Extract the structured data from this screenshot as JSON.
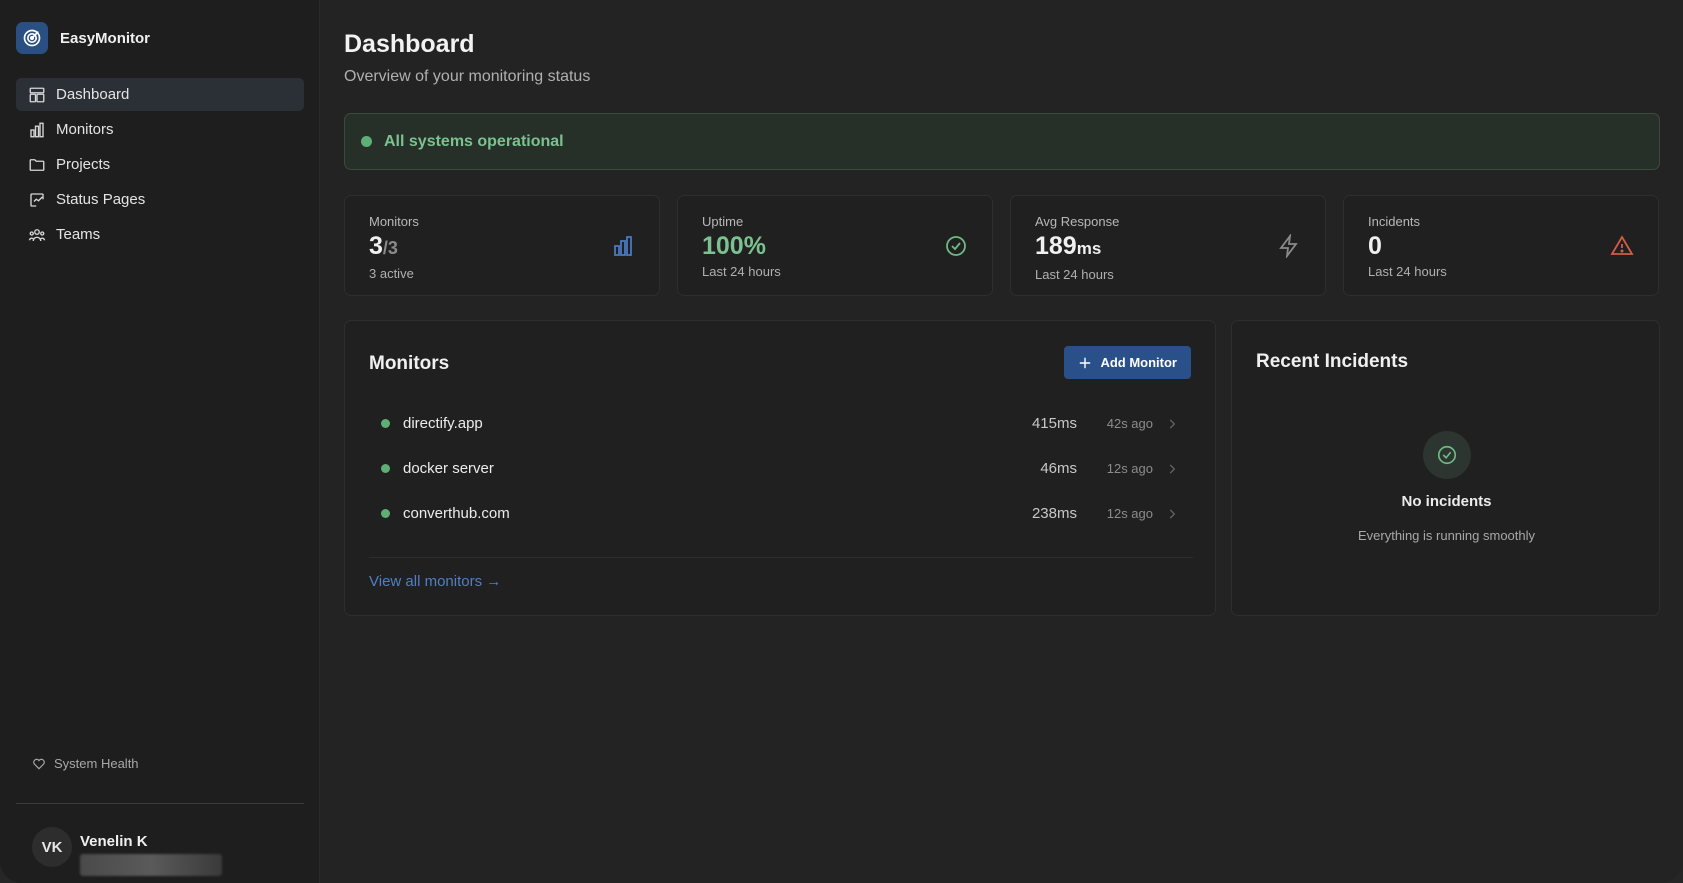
{
  "app": {
    "name": "EasyMonitor",
    "logo_icon": "radar-icon",
    "accent": "#2a5089"
  },
  "sidebar": {
    "items": [
      {
        "label": "Dashboard",
        "icon": "dashboard-icon",
        "active": true
      },
      {
        "label": "Monitors",
        "icon": "bar-chart-icon"
      },
      {
        "label": "Projects",
        "icon": "folder-icon"
      },
      {
        "label": "Status Pages",
        "icon": "status-page-icon"
      },
      {
        "label": "Teams",
        "icon": "users-icon"
      }
    ],
    "system_health": "System Health",
    "user": {
      "initials": "VK",
      "name": "Venelin K"
    }
  },
  "header": {
    "title": "Dashboard",
    "subtitle": "Overview of your monitoring status"
  },
  "status": {
    "text": "All systems operational",
    "color": "#5fae76"
  },
  "stats": [
    {
      "label": "Monitors",
      "value": "3",
      "sub": "/3",
      "note": "3 active",
      "icon": "bar-chart-icon"
    },
    {
      "label": "Uptime",
      "value": "100%",
      "note": "Last 24 hours",
      "icon": "check-circle-icon"
    },
    {
      "label": "Avg Response",
      "value": "189",
      "unit": "ms",
      "note": "Last 24 hours",
      "icon": "lightning-icon"
    },
    {
      "label": "Incidents",
      "value": "0",
      "note": "Last 24 hours",
      "icon": "warning-icon"
    }
  ],
  "monitors_panel": {
    "title": "Monitors",
    "add_label": "Add Monitor",
    "rows": [
      {
        "name": "directify.app",
        "response": "415ms",
        "ago": "42s ago",
        "status": "up"
      },
      {
        "name": "docker server",
        "response": "46ms",
        "ago": "12s ago",
        "status": "up"
      },
      {
        "name": "converthub.com",
        "response": "238ms",
        "ago": "12s ago",
        "status": "up"
      }
    ],
    "view_all": "View all monitors →"
  },
  "incidents_panel": {
    "title": "Recent Incidents",
    "empty_title": "No incidents",
    "empty_sub": "Everything is running smoothly"
  }
}
